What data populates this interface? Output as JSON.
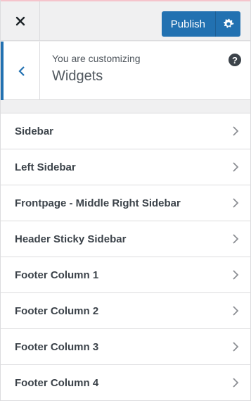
{
  "header": {
    "close_label": "×",
    "publish_label": "Publish",
    "settings_icon": "gear-icon",
    "accent_color": "#2271b1"
  },
  "section": {
    "pre_title": "You are customizing",
    "title": "Widgets",
    "help_label": "?"
  },
  "items": [
    {
      "label": "Sidebar"
    },
    {
      "label": "Left Sidebar"
    },
    {
      "label": "Frontpage - Middle Right Sidebar"
    },
    {
      "label": "Header Sticky Sidebar"
    },
    {
      "label": "Footer Column 1"
    },
    {
      "label": "Footer Column 2"
    },
    {
      "label": "Footer Column 3"
    },
    {
      "label": "Footer Column 4"
    }
  ]
}
